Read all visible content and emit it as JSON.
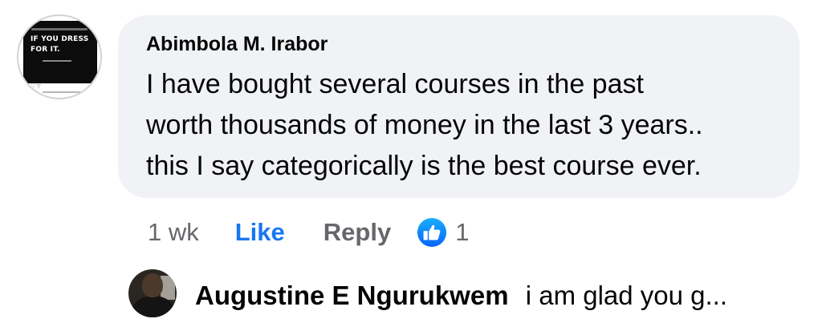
{
  "comment": {
    "avatar": {
      "post_lines": [
        "IF YOU DRESS",
        "FOR IT."
      ]
    },
    "author": "Abimbola M. Irabor",
    "text_lines": [
      "I have bought several courses in the past",
      "worth thousands of money in the last 3 years..",
      "this I say categorically is the best course ever."
    ],
    "timestamp": "1 wk",
    "like_label": "Like",
    "reply_label": "Reply",
    "reaction_icon": "like-reaction-icon",
    "reaction_count": "1"
  },
  "reply": {
    "author": "Augustine E Ngurukwem",
    "text": "i am glad you g...",
    "avatar_icon": "user-avatar"
  },
  "colors": {
    "bubble_bg": "#f0f2f5",
    "like_blue": "#1877f2",
    "meta_gray": "#65676b",
    "text": "#050505"
  }
}
